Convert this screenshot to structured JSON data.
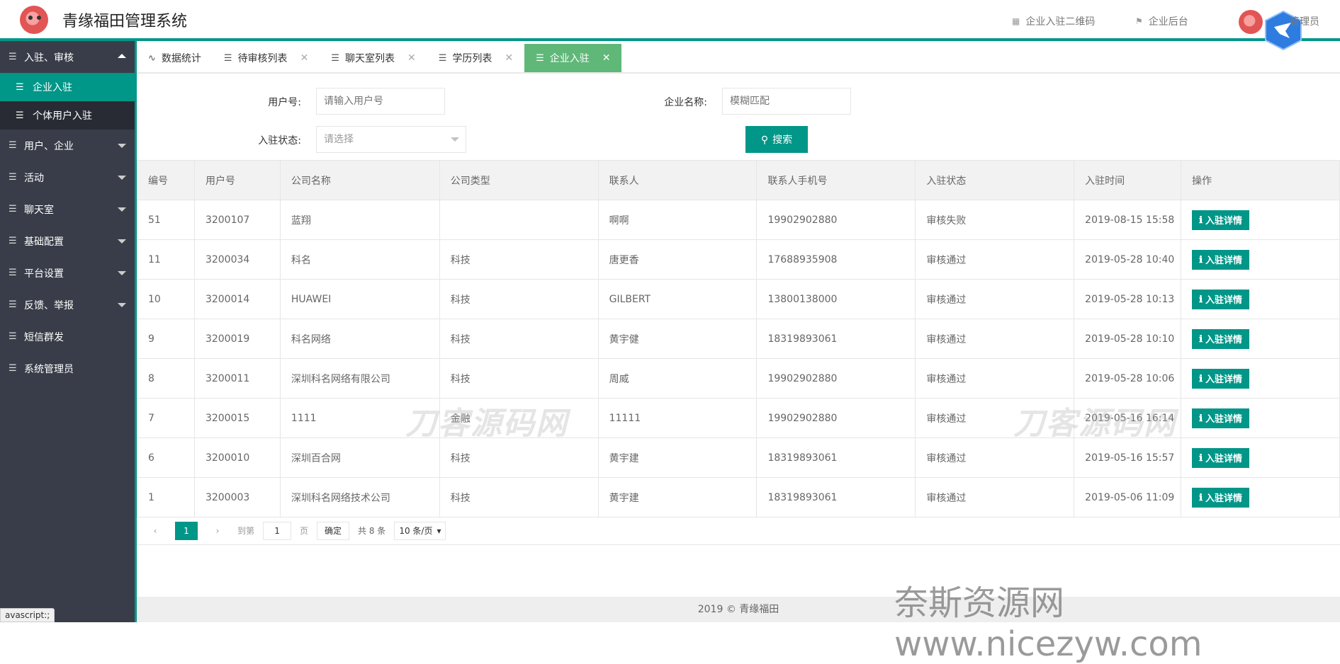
{
  "app": {
    "title": "青缘福田管理系统"
  },
  "header": {
    "qr_link": "企业入驻二维码",
    "backend_link": "企业后台",
    "admin_label": "管理员"
  },
  "sidebar": {
    "items": [
      {
        "label": "入驻、审核",
        "expanded": true,
        "children": [
          {
            "label": "企业入驻",
            "active": true
          },
          {
            "label": "个体用户入驻",
            "active": false
          }
        ]
      },
      {
        "label": "用户、企业",
        "expanded": false
      },
      {
        "label": "活动",
        "expanded": false
      },
      {
        "label": "聊天室",
        "expanded": false
      },
      {
        "label": "基础配置",
        "expanded": false
      },
      {
        "label": "平台设置",
        "expanded": false
      },
      {
        "label": "反馈、举报",
        "expanded": false
      },
      {
        "label": "短信群发"
      },
      {
        "label": "系统管理员"
      }
    ]
  },
  "status_tip": "avascript:;",
  "tabs": [
    {
      "label": "数据统计",
      "closable": false,
      "active": false
    },
    {
      "label": "待审核列表",
      "closable": true,
      "active": false
    },
    {
      "label": "聊天室列表",
      "closable": true,
      "active": false
    },
    {
      "label": "学历列表",
      "closable": true,
      "active": false
    },
    {
      "label": "企业入驻",
      "closable": true,
      "active": true
    }
  ],
  "filters": {
    "user_id_label": "用户号:",
    "user_id_placeholder": "请输入用户号",
    "company_label": "企业名称:",
    "company_placeholder": "模糊匹配",
    "status_label": "入驻状态:",
    "status_placeholder": "请选择",
    "search_label": "搜索"
  },
  "table": {
    "columns": [
      "编号",
      "用户号",
      "公司名称",
      "公司类型",
      "联系人",
      "联系人手机号",
      "入驻状态",
      "入驻时间",
      "操作"
    ],
    "action_label": "入驻详情",
    "rows": [
      [
        "51",
        "3200107",
        "蓝翔",
        "",
        "啊啊",
        "19902902880",
        "审核失败",
        "2019-08-15 15:58"
      ],
      [
        "11",
        "3200034",
        "科名",
        "科技",
        "唐更香",
        "17688935908",
        "审核通过",
        "2019-05-28 10:40"
      ],
      [
        "10",
        "3200014",
        "HUAWEI",
        "科技",
        "GILBERT",
        "13800138000",
        "审核通过",
        "2019-05-28 10:13"
      ],
      [
        "9",
        "3200019",
        "科名网络",
        "科技",
        "黄宇健",
        "18319893061",
        "审核通过",
        "2019-05-28 10:10"
      ],
      [
        "8",
        "3200011",
        "深圳科名网络有限公司",
        "科技",
        "周威",
        "19902902880",
        "审核通过",
        "2019-05-28 10:06"
      ],
      [
        "7",
        "3200015",
        "1111",
        "金融",
        "11111",
        "19902902880",
        "审核通过",
        "2019-05-16 16:14"
      ],
      [
        "6",
        "3200010",
        "深圳百合网",
        "科技",
        "黄宇建",
        "18319893061",
        "审核通过",
        "2019-05-16 15:57"
      ],
      [
        "1",
        "3200003",
        "深圳科名网络技术公司",
        "科技",
        "黄宇建",
        "18319893061",
        "审核通过",
        "2019-05-06 11:09"
      ]
    ]
  },
  "pager": {
    "current_page": "1",
    "goto_label": "到第",
    "goto_value": "1",
    "page_unit": "页",
    "confirm_label": "确定",
    "total_label": "共 8 条",
    "page_size": "10 条/页"
  },
  "footer": "2019 © 青缘福田",
  "watermarks": {
    "text1": "刀客源码网",
    "text2": "刀客源码网",
    "site": "奈斯资源网www.nicezyw.com"
  },
  "colors": {
    "accent": "#009688",
    "sidebar": "#393d49",
    "active_tab": "#5fb878"
  }
}
